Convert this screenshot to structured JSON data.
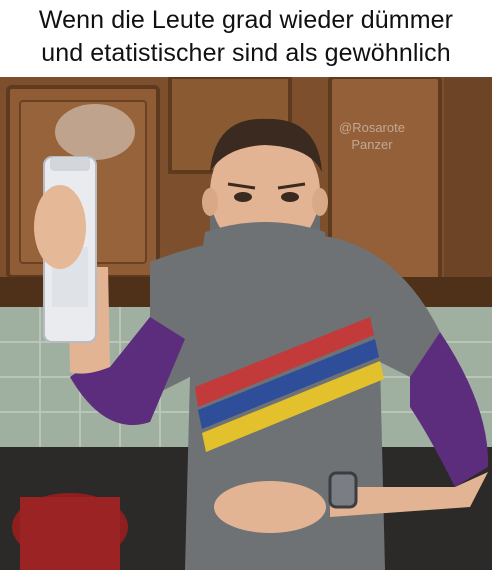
{
  "caption": {
    "line1": "Wenn die Leute grad wieder dümmer",
    "line2": "und etatistischer sind als gewöhnlich"
  },
  "photo": {
    "watermark_line1": "@Rosarote",
    "watermark_line2": "Panzer"
  },
  "colors": {
    "cabinet": "#8a5a34",
    "cabinet_dark": "#5e3a1f",
    "shirt": "#6f7275",
    "sleeve": "#5b2d7c",
    "stripe_red": "#c23a3a",
    "stripe_blue": "#2f4e9a",
    "stripe_yellow": "#e3c12c",
    "skin": "#e2b494",
    "tile": "#9fb0a0"
  }
}
